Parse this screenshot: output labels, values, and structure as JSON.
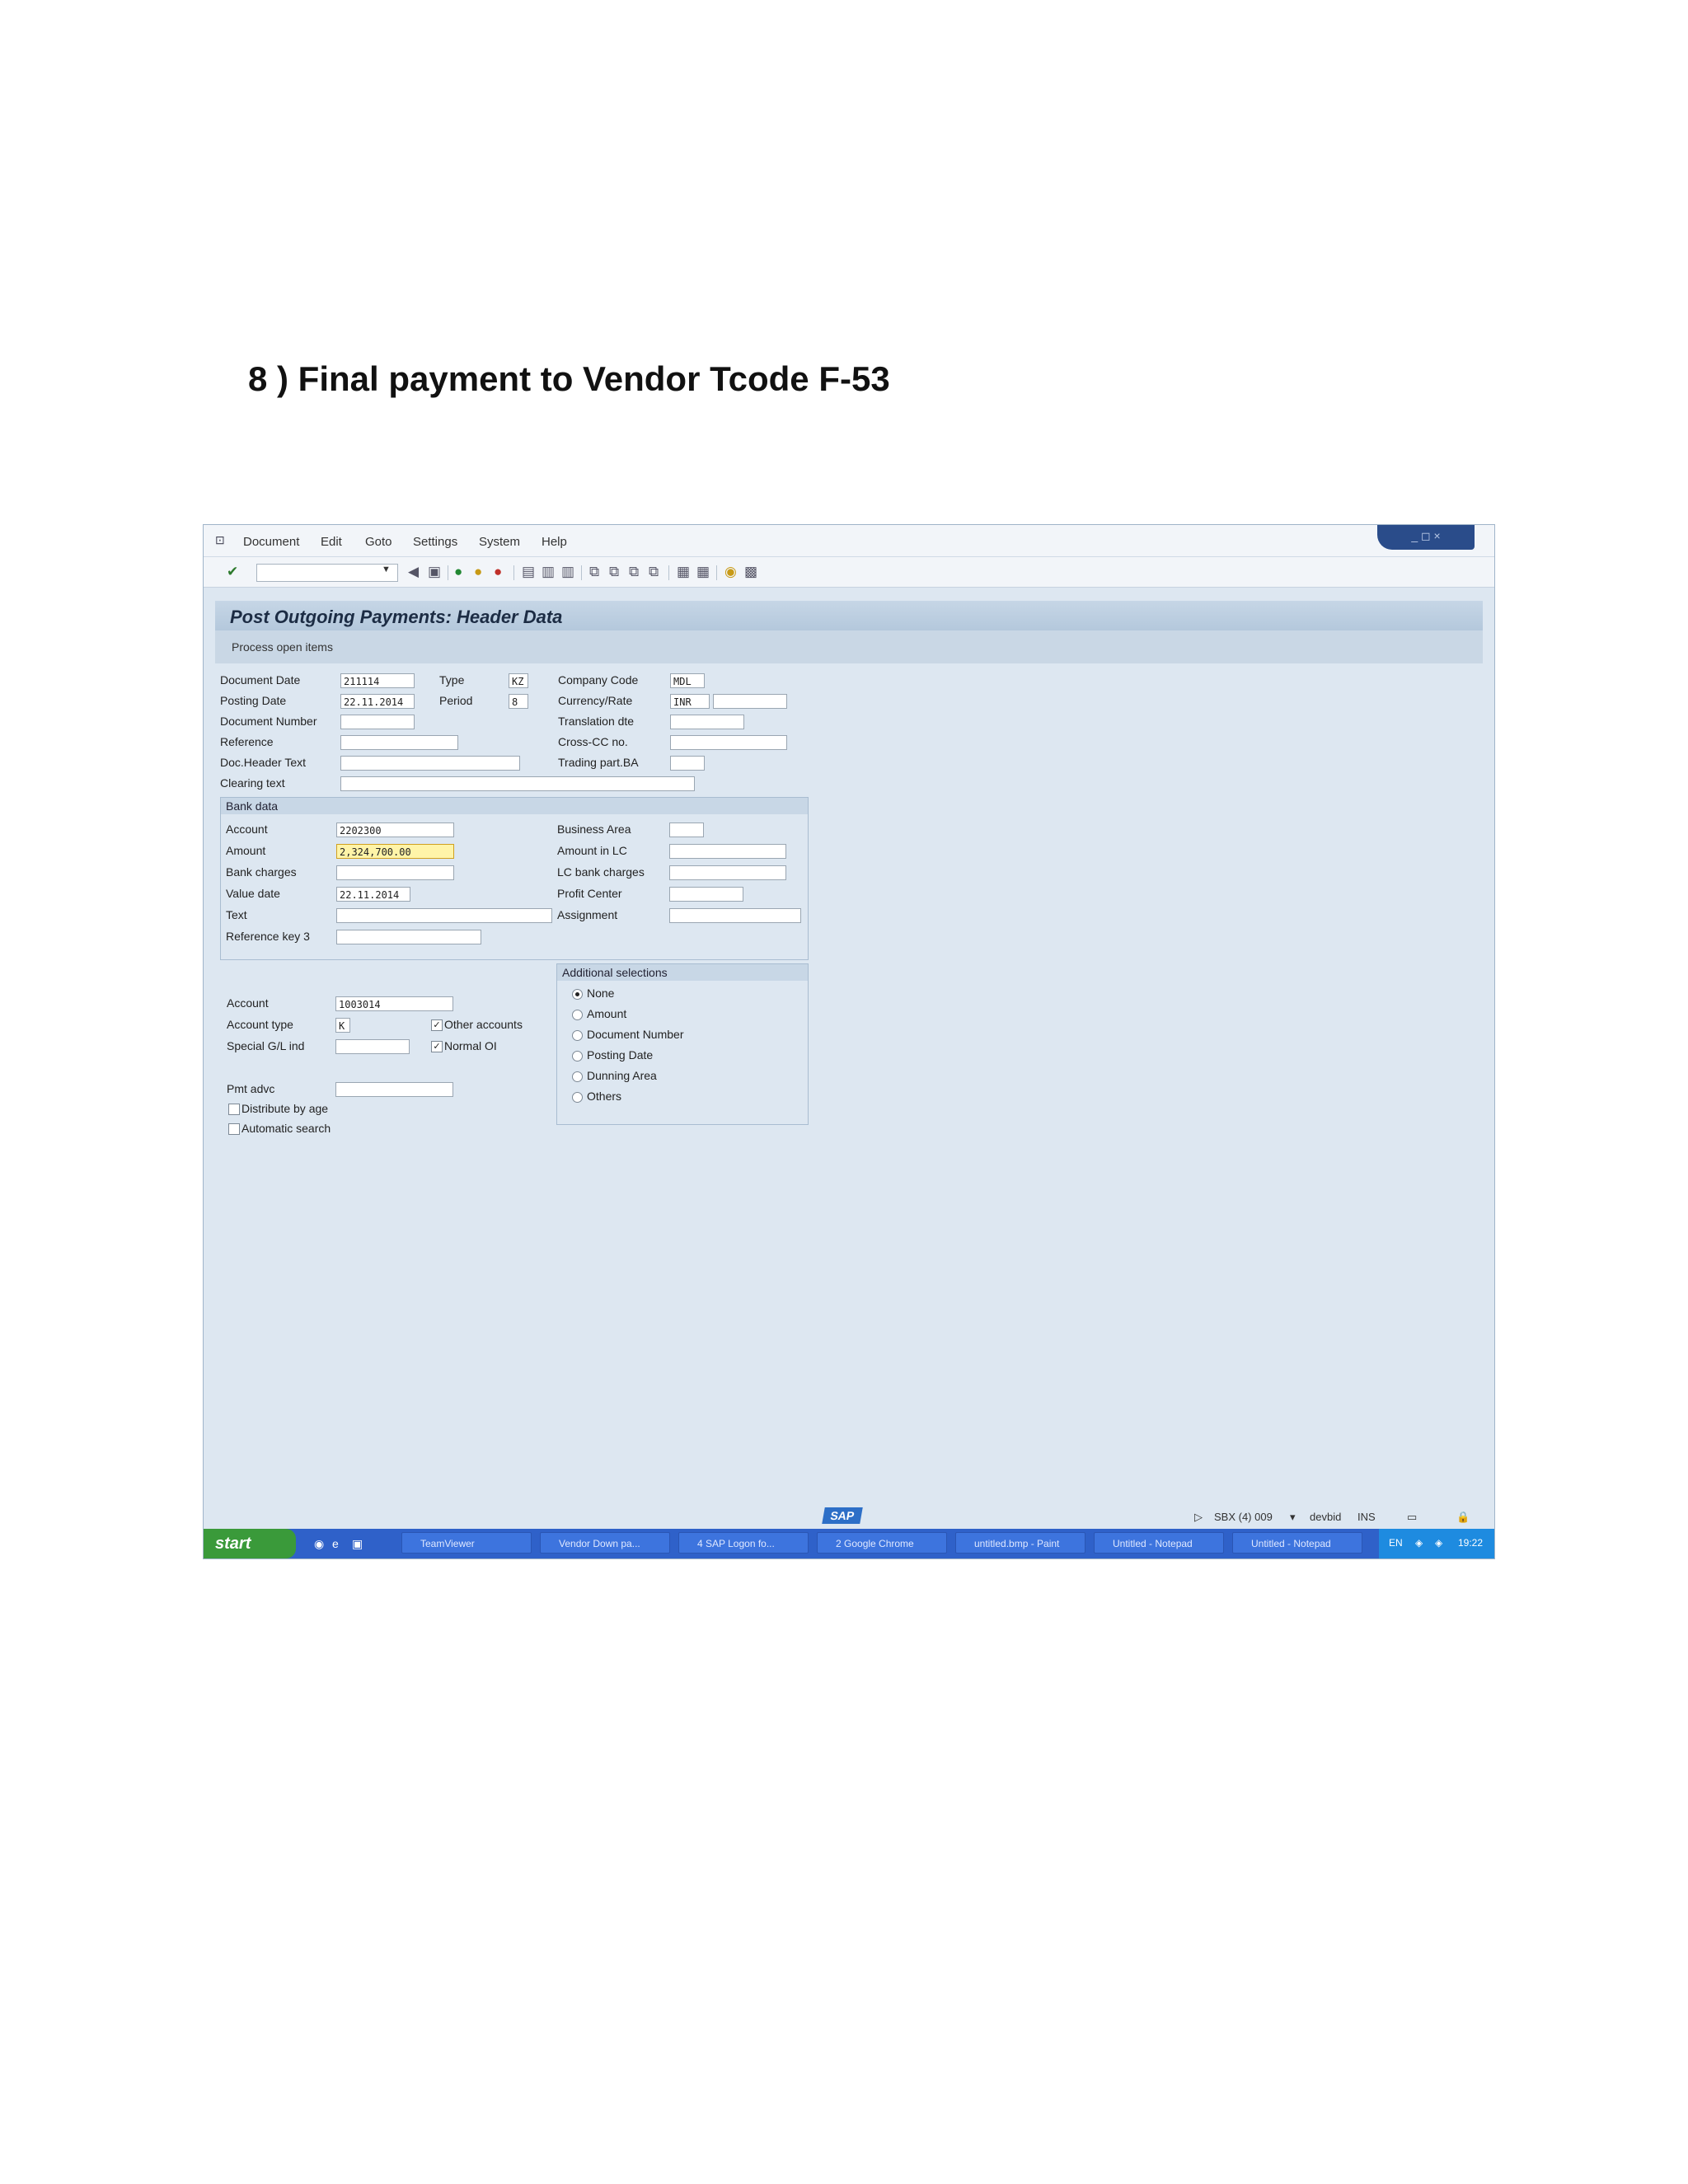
{
  "document": {
    "heading": "8 ) Final payment to Vendor  Tcode F-53"
  },
  "menu": [
    "Document",
    "Edit",
    "Goto",
    "Settings",
    "System",
    "Help"
  ],
  "window_controls": "_ ◻ ×",
  "title": "Post Outgoing Payments: Header Data",
  "app_toolbar": {
    "process_open_items": "Process open items"
  },
  "header": {
    "document_date_label": "Document Date",
    "document_date": "211114",
    "type_label": "Type",
    "type": "KZ",
    "company_code_label": "Company Code",
    "company_code": "MDL",
    "posting_date_label": "Posting Date",
    "posting_date": "22.11.2014",
    "period_label": "Period",
    "period": "8",
    "currency_rate_label": "Currency/Rate",
    "currency": "INR",
    "document_number_label": "Document Number",
    "translation_date_label": "Translation dte",
    "reference_label": "Reference",
    "cross_cc_label": "Cross-CC no.",
    "doc_header_text_label": "Doc.Header Text",
    "trading_part_ba_label": "Trading part.BA",
    "clearing_text_label": "Clearing text"
  },
  "bank_data": {
    "title": "Bank data",
    "account_label": "Account",
    "account": "2202300",
    "amount_label": "Amount",
    "amount": "2,324,700.00",
    "bank_charges_label": "Bank charges",
    "value_date_label": "Value date",
    "value_date": "22.11.2014",
    "text_label": "Text",
    "reference_key3_label": "Reference key 3",
    "business_area_label": "Business Area",
    "amount_in_lc_label": "Amount in LC",
    "lc_bank_charges_label": "LC bank charges",
    "profit_center_label": "Profit Center",
    "assignment_label": "Assignment"
  },
  "open_items": {
    "account_label": "Account",
    "account": "1003014",
    "account_type_label": "Account type",
    "account_type": "K",
    "other_accounts_label": "Other accounts",
    "special_gl_label": "Special G/L ind",
    "normal_oi_label": "Normal OI",
    "pmt_advice_label": "Pmt advc",
    "distribute_by_age_label": "Distribute by age",
    "automatic_search_label": "Automatic search"
  },
  "additional_selections": {
    "title": "Additional selections",
    "options": [
      "None",
      "Amount",
      "Document Number",
      "Posting Date",
      "Dunning Area",
      "Others"
    ],
    "selected": "None"
  },
  "status": {
    "sap_logo": "SAP",
    "system": "SBX (4) 009",
    "server": "devbid",
    "mode": "INS"
  },
  "taskbar": {
    "start": "start",
    "tasks": [
      "TeamViewer",
      "Vendor Down pa...",
      "4 SAP Logon fo...",
      "2 Google Chrome",
      "untitled.bmp - Paint",
      "Untitled - Notepad",
      "Untitled - Notepad"
    ],
    "lang": "EN",
    "clock": "19:22"
  }
}
